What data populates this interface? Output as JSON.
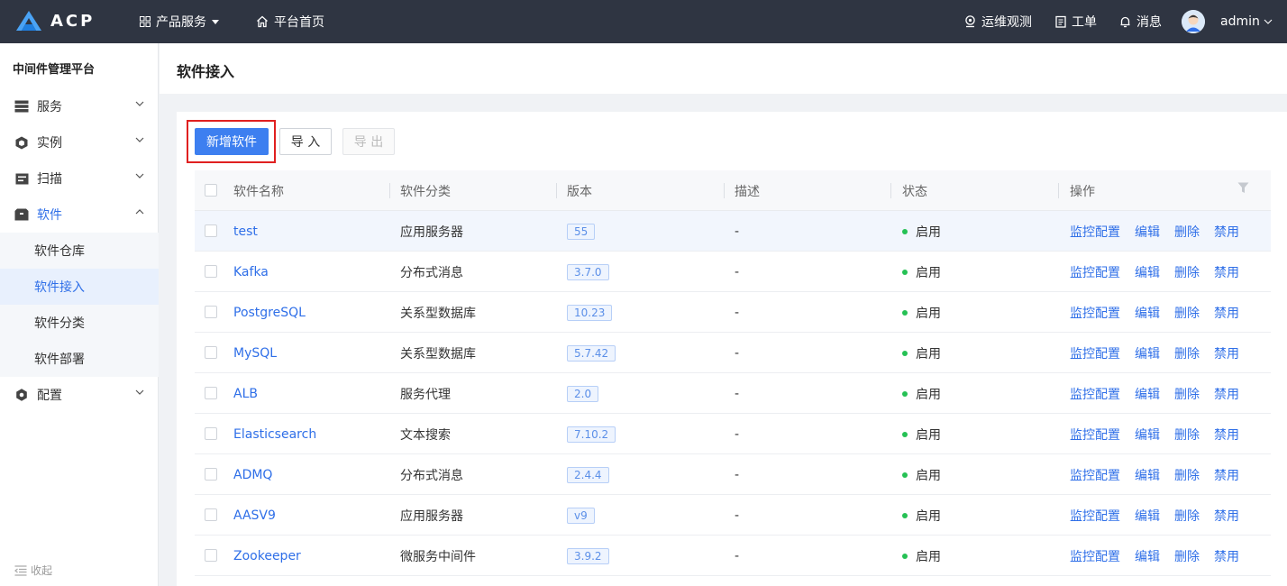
{
  "topbar": {
    "logo_text": "ACP",
    "product_services": "产品服务",
    "platform_home": "平台首页",
    "ops_observe": "运维观测",
    "ticket": "工单",
    "message": "消息",
    "username": "admin"
  },
  "sidebar": {
    "platform_title": "中间件管理平台",
    "menu": {
      "service": "服务",
      "instance": "实例",
      "scan": "扫描",
      "software": "软件",
      "config": "配置"
    },
    "software_sub": {
      "repo": "软件仓库",
      "access": "软件接入",
      "category": "软件分类",
      "deploy": "软件部署"
    },
    "collapse": "收起"
  },
  "page": {
    "title": "软件接入"
  },
  "toolbar": {
    "add_label": "新增软件",
    "import_label": "导 入",
    "export_label": "导 出"
  },
  "table": {
    "headers": {
      "name": "软件名称",
      "category": "软件分类",
      "version": "版本",
      "desc": "描述",
      "status": "状态",
      "ops": "操作"
    },
    "op_labels": {
      "monitor": "监控配置",
      "edit": "编辑",
      "delete": "删除",
      "disable": "禁用"
    },
    "rows": [
      {
        "name": "test",
        "category": "应用服务器",
        "version": "55",
        "desc": "-",
        "status": "启用"
      },
      {
        "name": "Kafka",
        "category": "分布式消息",
        "version": "3.7.0",
        "desc": "-",
        "status": "启用"
      },
      {
        "name": "PostgreSQL",
        "category": "关系型数据库",
        "version": "10.23",
        "desc": "-",
        "status": "启用"
      },
      {
        "name": "MySQL",
        "category": "关系型数据库",
        "version": "5.7.42",
        "desc": "-",
        "status": "启用"
      },
      {
        "name": "ALB",
        "category": "服务代理",
        "version": "2.0",
        "desc": "-",
        "status": "启用"
      },
      {
        "name": "Elasticsearch",
        "category": "文本搜索",
        "version": "7.10.2",
        "desc": "-",
        "status": "启用"
      },
      {
        "name": "ADMQ",
        "category": "分布式消息",
        "version": "2.4.4",
        "desc": "-",
        "status": "启用"
      },
      {
        "name": "AASV9",
        "category": "应用服务器",
        "version": "v9",
        "desc": "-",
        "status": "启用"
      },
      {
        "name": "Zookeeper",
        "category": "微服务中间件",
        "version": "3.9.2",
        "desc": "-",
        "status": "启用"
      }
    ]
  },
  "colors": {
    "topbar_bg": "#2f3542",
    "primary": "#3d7ff0",
    "link": "#2f6fe8",
    "status_enabled": "#25c154",
    "highlight": "#e02020"
  }
}
